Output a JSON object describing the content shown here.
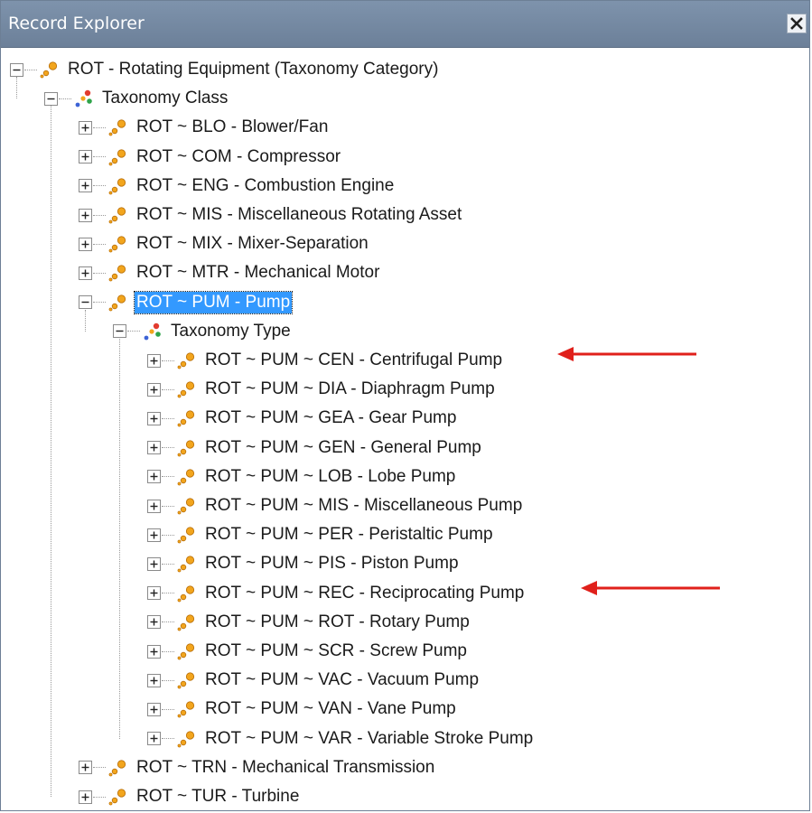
{
  "window": {
    "title": "Record Explorer",
    "close_glyph": "✕"
  },
  "tree": {
    "root": "ROT - Rotating Equipment (Taxonomy Category)",
    "class_group": "Taxonomy Class",
    "classes_before": [
      "ROT ~ BLO - Blower/Fan",
      "ROT ~ COM - Compressor",
      "ROT ~ ENG - Combustion Engine",
      "ROT ~ MIS - Miscellaneous Rotating Asset",
      "ROT ~ MIX - Mixer-Separation",
      "ROT ~ MTR - Mechanical Motor"
    ],
    "selected_class": "ROT ~ PUM - Pump",
    "type_group": "Taxonomy Type",
    "types": [
      "ROT ~ PUM ~ CEN - Centrifugal Pump",
      "ROT ~ PUM ~ DIA - Diaphragm Pump",
      "ROT ~ PUM ~ GEA - Gear Pump",
      "ROT ~ PUM ~ GEN - General Pump",
      "ROT ~ PUM ~ LOB - Lobe Pump",
      "ROT ~ PUM ~ MIS - Miscellaneous Pump",
      "ROT ~ PUM ~ PER - Peristaltic Pump",
      "ROT ~ PUM ~ PIS - Piston Pump",
      "ROT ~ PUM ~ REC - Reciprocating Pump",
      "ROT ~ PUM ~ ROT - Rotary Pump",
      "ROT ~ PUM ~ SCR - Screw Pump",
      "ROT ~ PUM ~ VAC - Vacuum Pump",
      "ROT ~ PUM ~ VAN - Vane Pump",
      "ROT ~ PUM ~ VAR - Variable Stroke Pump"
    ],
    "classes_after": [
      "ROT ~ TRN - Mechanical Transmission",
      "ROT ~ TUR - Turbine"
    ]
  },
  "icons": {
    "expanded": "minus-box-icon",
    "collapsed": "plus-box-icon",
    "record": "family-icon",
    "group": "multi-color-family-icon"
  },
  "colors": {
    "titlebar": "#748aa3",
    "selection": "#3399ff",
    "annotation_arrow": "#e0201b",
    "record_icon_orange": "#f0a020"
  }
}
